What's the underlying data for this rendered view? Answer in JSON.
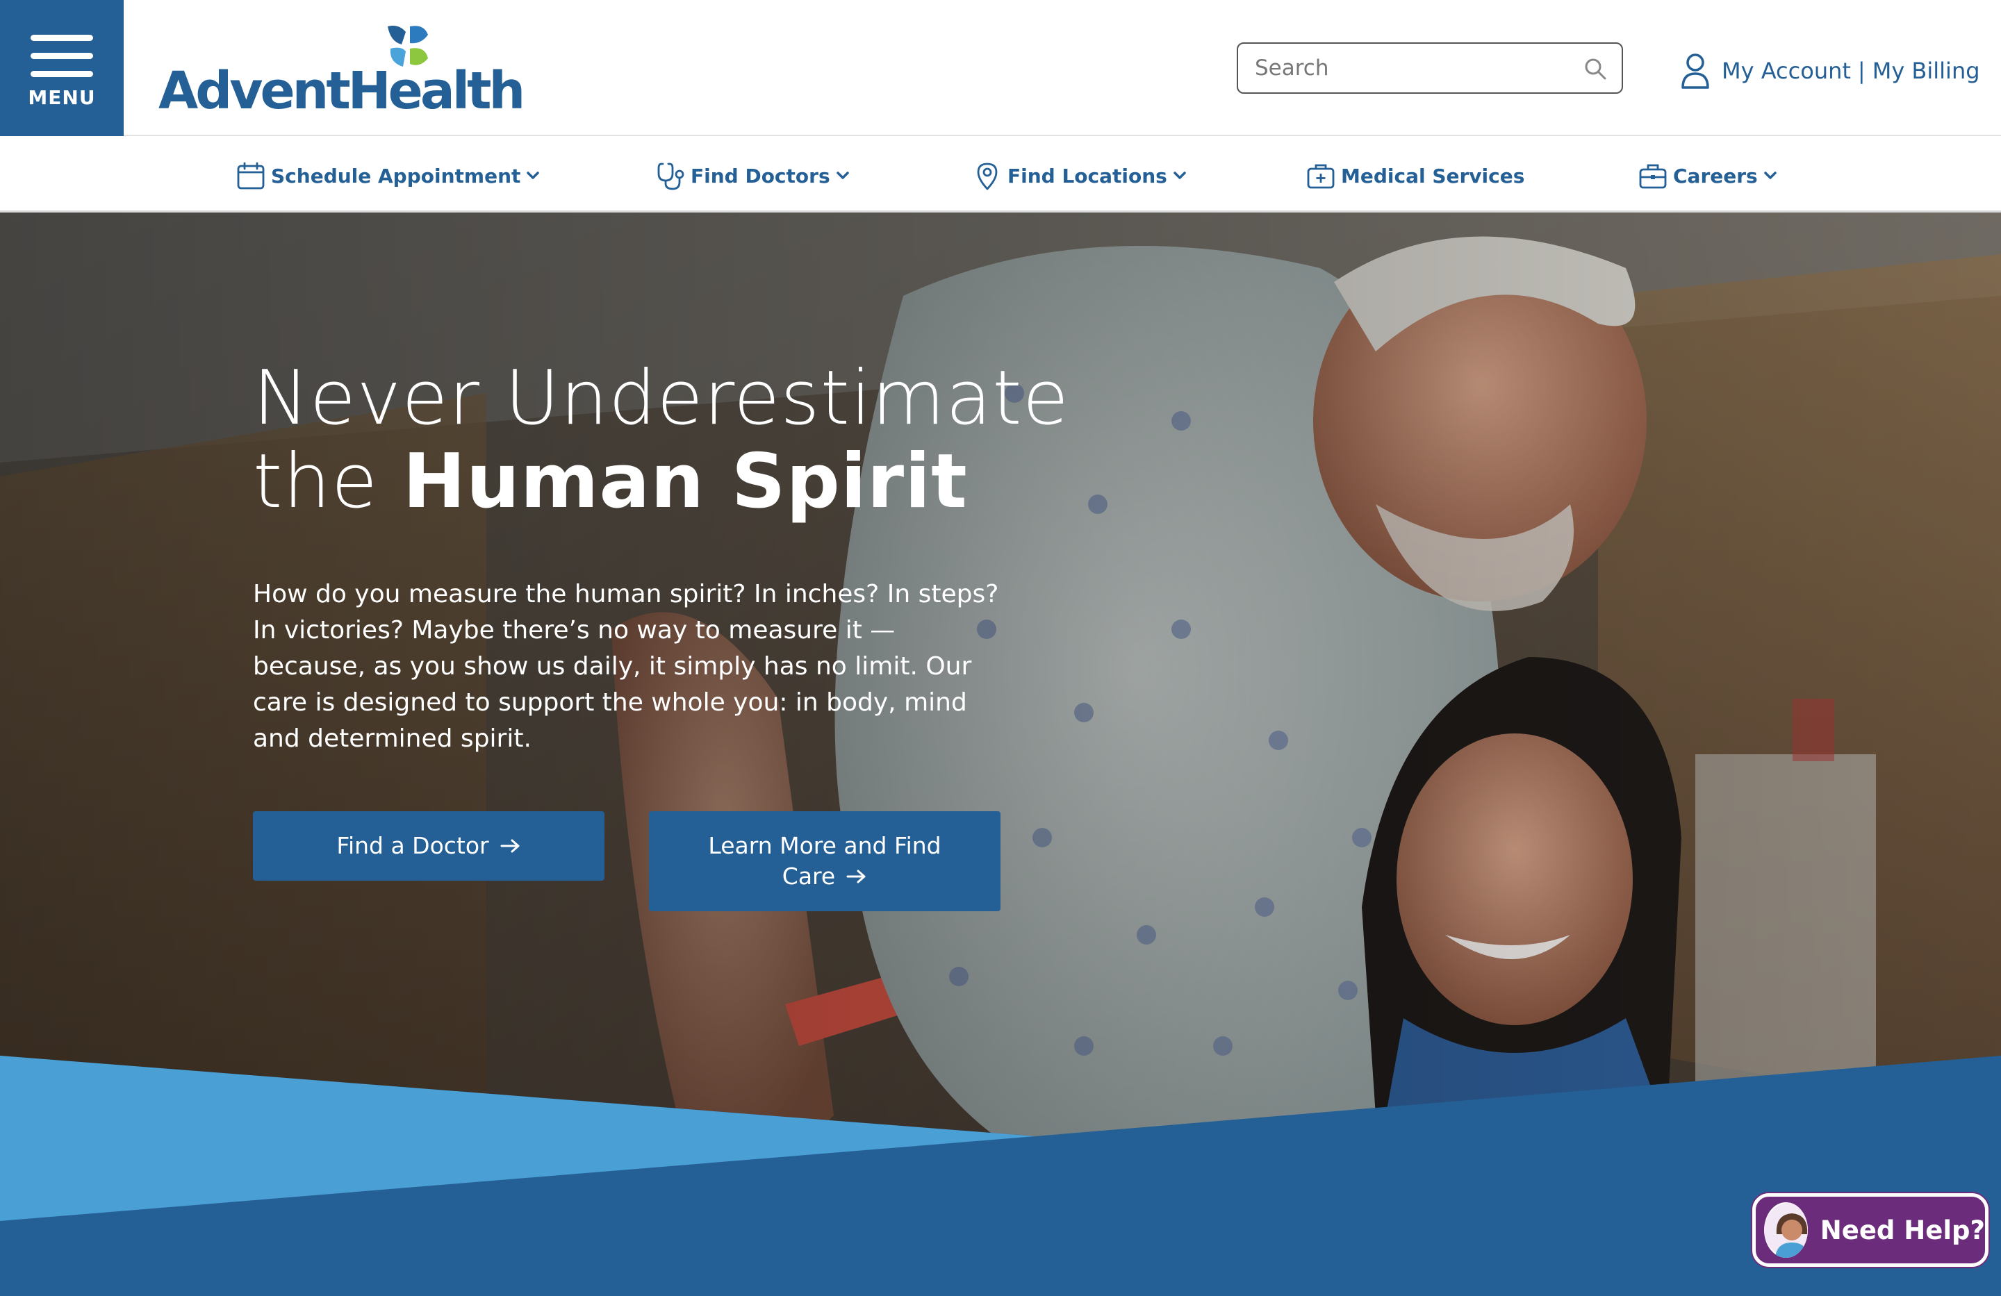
{
  "header": {
    "menu_label": "MENU",
    "logo_text": "AdventHealth",
    "search_placeholder": "Search",
    "account_label": "My Account",
    "separator": "|",
    "billing_label": "My Billing"
  },
  "nav": {
    "items": [
      {
        "label": "Schedule Appointment",
        "icon": "calendar-icon",
        "has_dropdown": true
      },
      {
        "label": "Find Doctors",
        "icon": "stethoscope-icon",
        "has_dropdown": true
      },
      {
        "label": "Find Locations",
        "icon": "location-pin-icon",
        "has_dropdown": true
      },
      {
        "label": "Medical Services",
        "icon": "medical-kit-icon",
        "has_dropdown": false
      },
      {
        "label": "Careers",
        "icon": "briefcase-icon",
        "has_dropdown": true
      }
    ]
  },
  "hero": {
    "title_line1": "Never Underestimate",
    "title_line2_prefix": "the ",
    "title_line2_strong": "Human Spirit",
    "body": "How do you measure the human spirit? In inches? In steps? In victories? Maybe there’s no way to measure it — because, as you show us daily, it simply has no limit. Our care is designed to support the whole you: in body, mind and determined spirit.",
    "button_primary": "Find a Doctor",
    "button_secondary_line1": "Learn More and Find",
    "button_secondary_line2": "Care"
  },
  "chat": {
    "label": "Need Help?"
  },
  "colors": {
    "brand_blue": "#245f96",
    "light_blue": "#4a9fd4",
    "logo_green": "#8dc63f",
    "chat_purple": "#6b2d7b"
  }
}
